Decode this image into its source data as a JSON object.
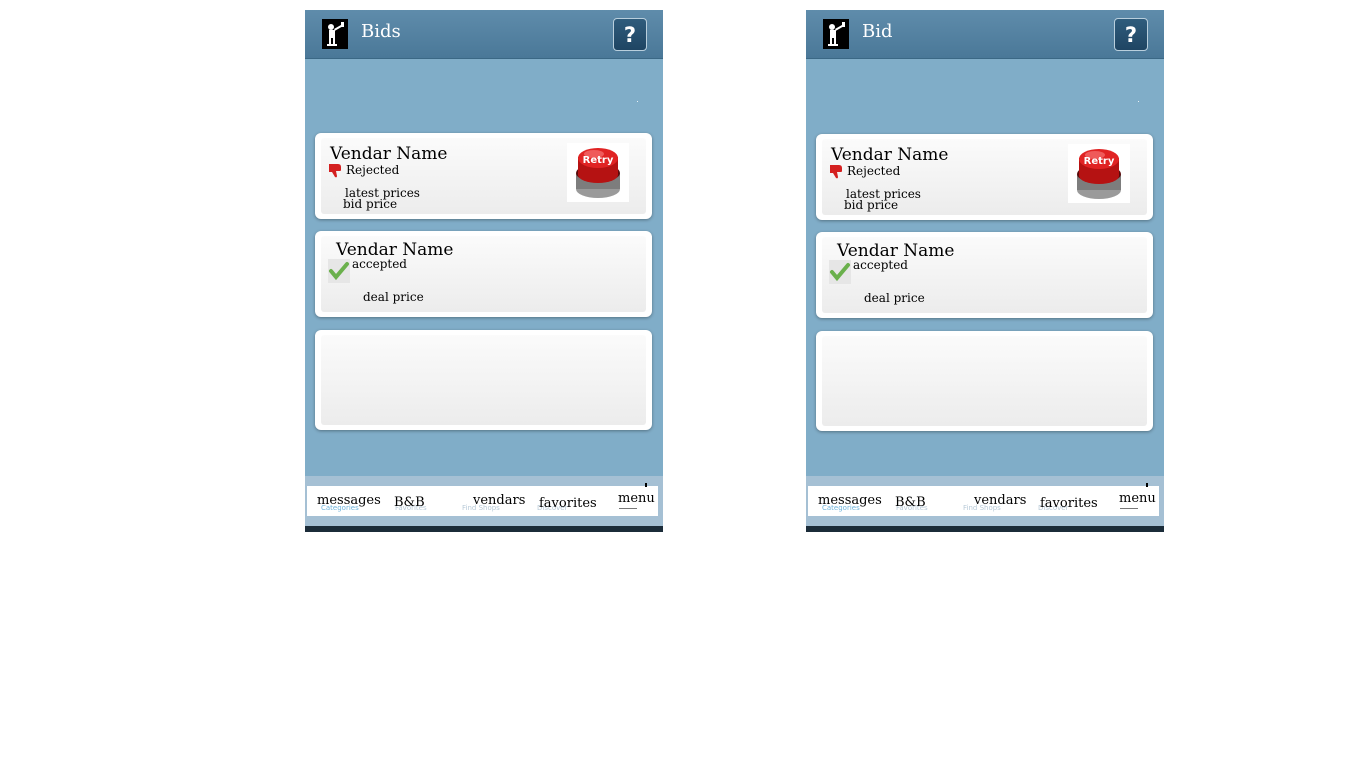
{
  "phones": [
    {
      "title": "Bids",
      "help_label": "?",
      "cards": [
        {
          "vendor_name": "Vendar Name",
          "status": "Rejected",
          "status_icon": "thumbs-down-icon",
          "line1": "latest prices",
          "line2": "bid price",
          "retry_label": "Retry"
        },
        {
          "vendor_name": "Vendar Name",
          "status": "accepted",
          "status_icon": "checkmark-icon",
          "line1": "deal price"
        }
      ],
      "tabs": [
        {
          "label": "messages",
          "ghost": "Categories"
        },
        {
          "label": "B&B",
          "ghost": "Favorites"
        },
        {
          "label": "vendars",
          "ghost": "Find Shops"
        },
        {
          "label": "favorites",
          "ghost": "Discover"
        },
        {
          "label": "menu"
        }
      ]
    },
    {
      "title": "Bid",
      "help_label": "?",
      "cards": [
        {
          "vendor_name": "Vendar Name",
          "status": "Rejected",
          "status_icon": "thumbs-down-icon",
          "line1": "latest prices",
          "line2": "bid price",
          "retry_label": "Retry"
        },
        {
          "vendor_name": "Vendar Name",
          "status": "accepted",
          "status_icon": "checkmark-icon",
          "line1": "deal price"
        }
      ],
      "tabs": [
        {
          "label": "messages",
          "ghost": "Categories"
        },
        {
          "label": "B&B",
          "ghost": "Favorites"
        },
        {
          "label": "vendars",
          "ghost": "Find Shops"
        },
        {
          "label": "favorites",
          "ghost": "Discover"
        },
        {
          "label": "menu"
        }
      ]
    }
  ],
  "colors": {
    "background": "#80adc8",
    "header": "#4a7898",
    "help_button": "#1f4563",
    "retry_red": "#d61a1a",
    "check_green": "#6ab04c",
    "thumb_red": "#d42020"
  }
}
